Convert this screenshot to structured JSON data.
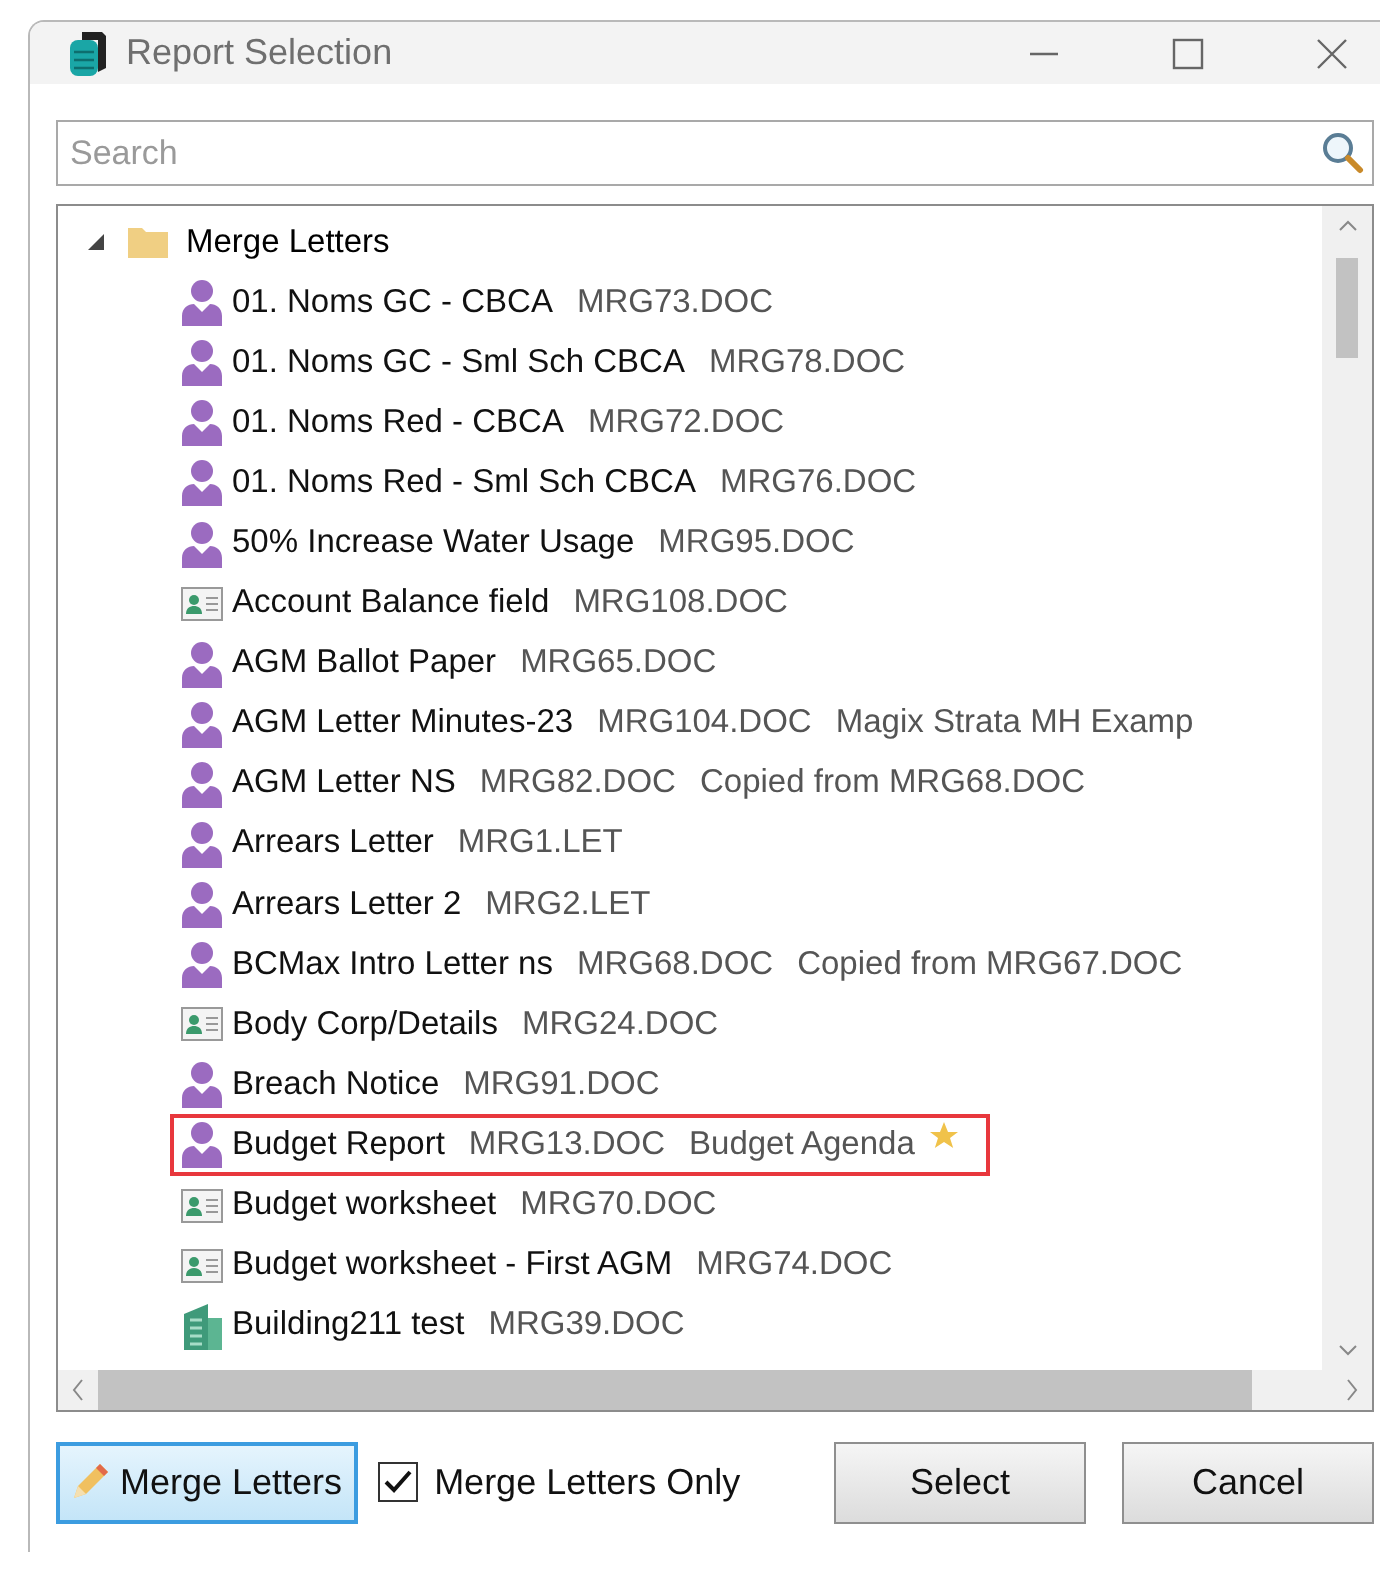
{
  "window": {
    "title": "Report Selection"
  },
  "search": {
    "placeholder": "Search"
  },
  "tree": {
    "label": "Merge Letters",
    "expanded": true,
    "children": [
      {
        "kind": "person",
        "name": "01. Noms GC - CBCA",
        "file": "MRG73.DOC"
      },
      {
        "kind": "person",
        "name": "01. Noms GC - Sml Sch CBCA",
        "file": "MRG78.DOC"
      },
      {
        "kind": "person",
        "name": "01. Noms Red - CBCA",
        "file": "MRG72.DOC"
      },
      {
        "kind": "person",
        "name": "01. Noms Red - Sml Sch CBCA",
        "file": "MRG76.DOC"
      },
      {
        "kind": "person",
        "name": "50% Increase Water Usage",
        "file": "MRG95.DOC"
      },
      {
        "kind": "card",
        "name": "Account Balance field",
        "file": "MRG108.DOC"
      },
      {
        "kind": "person",
        "name": "AGM Ballot Paper",
        "file": "MRG65.DOC"
      },
      {
        "kind": "person",
        "name": "AGM Letter Minutes-23",
        "file": "MRG104.DOC",
        "note": "Magix Strata MH Examp"
      },
      {
        "kind": "person",
        "name": "AGM Letter NS",
        "file": "MRG82.DOC",
        "note": "Copied from MRG68.DOC"
      },
      {
        "kind": "person",
        "name": "Arrears Letter",
        "file": "MRG1.LET"
      },
      {
        "kind": "person",
        "name": "Arrears Letter 2",
        "file": "MRG2.LET"
      },
      {
        "kind": "person",
        "name": "BCMax Intro Letter ns",
        "file": "MRG68.DOC",
        "note": "Copied from MRG67.DOC"
      },
      {
        "kind": "card",
        "name": "Body Corp/Details",
        "file": "MRG24.DOC"
      },
      {
        "kind": "person",
        "name": "Breach Notice",
        "file": "MRG91.DOC"
      },
      {
        "kind": "person",
        "name": "Budget Report",
        "file": "MRG13.DOC",
        "note": "Budget Agenda",
        "starred": true,
        "highlighted": true
      },
      {
        "kind": "card",
        "name": "Budget worksheet",
        "file": "MRG70.DOC"
      },
      {
        "kind": "card",
        "name": "Budget worksheet - First AGM",
        "file": "MRG74.DOC"
      },
      {
        "kind": "building",
        "name": "Building211 test",
        "file": "MRG39.DOC"
      }
    ]
  },
  "buttons": {
    "merge": "Merge Letters",
    "select": "Select",
    "cancel": "Cancel"
  },
  "merge_only": {
    "label": "Merge Letters Only",
    "checked": true
  }
}
